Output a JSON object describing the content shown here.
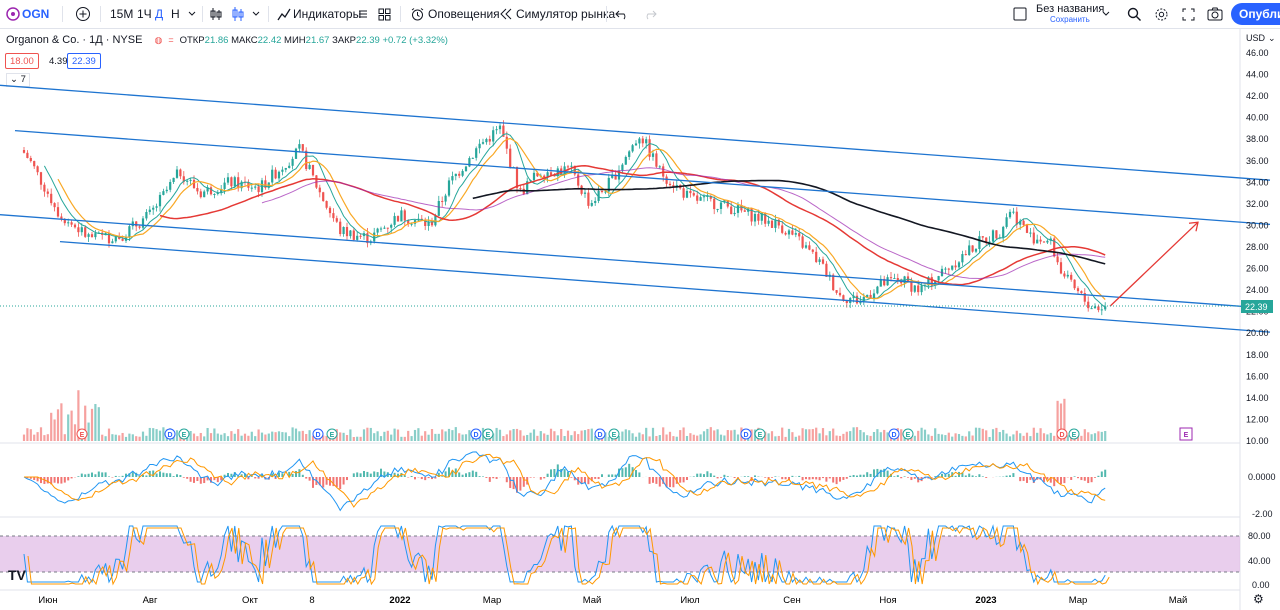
{
  "toolbar": {
    "symbol": "OGN",
    "add_symbol_icon": "plus-circle-icon",
    "intervals": [
      "15M",
      "1Ч",
      "Д",
      "Н"
    ],
    "active_interval": "Д",
    "indicators_label": "Индикаторы",
    "alerts_label": "Оповещения",
    "replay_label": "Симулятор рынка",
    "layout_name": "Без названия",
    "layout_status": "Сохранить",
    "publish_label": "Опубликовать"
  },
  "legend": {
    "title": "Organon & Co. · 1Д · NYSE",
    "open_label": "ОТКР",
    "open": "21.86",
    "high_label": "МАКС",
    "high": "22.42",
    "low_label": "МИН",
    "low": "21.67",
    "close_label": "ЗАКР",
    "close": "22.39",
    "change": "+0.72 (+3.32%)",
    "sell_price": "18.00",
    "spread": "4.39",
    "buy_price": "22.39",
    "indicators_count": "7"
  },
  "price_axis": {
    "currency": "USD",
    "labels": [
      "46.00",
      "44.00",
      "42.00",
      "40.00",
      "38.00",
      "36.00",
      "34.00",
      "32.00",
      "30.00",
      "28.00",
      "26.00",
      "24.00",
      "22.00",
      "20.00",
      "18.00",
      "16.00",
      "14.00",
      "12.00",
      "10.00"
    ],
    "last_price": "22.39",
    "macd_labels": [
      "0.0000",
      "-2.00"
    ],
    "stoch_labels": [
      "80.00",
      "40.00",
      "0.00"
    ]
  },
  "time_axis": {
    "labels": [
      "Июн",
      "Авг",
      "Окт",
      "8",
      "2022",
      "Мар",
      "Май",
      "Июл",
      "Сен",
      "Ноя",
      "2023",
      "Мар",
      "Май"
    ],
    "bold": [
      "2022",
      "2023"
    ]
  },
  "events": [
    "E",
    "D",
    "E",
    "D",
    "E",
    "D",
    "E",
    "D",
    "E",
    "D",
    "E",
    "D",
    "E",
    "D",
    "E"
  ],
  "colors": {
    "channel": "#1e74d0",
    "arrow": "#e53935",
    "ma_fast": "#e53935",
    "ma_slow": "#131722",
    "ma_purple": "#9c27b0",
    "up": "#26a69a",
    "down": "#ef5350",
    "stoch_band": "#e1bee7",
    "publish": "#2962ff"
  },
  "chart_data": {
    "type": "candlestick",
    "symbol": "OGN",
    "timeframe": "1D",
    "y_range": [
      20,
      46
    ],
    "last_close": 22.39,
    "price_path": [
      [
        0,
        31
      ],
      [
        10,
        38.5
      ],
      [
        30,
        36
      ],
      [
        60,
        31
      ],
      [
        90,
        28.8
      ],
      [
        120,
        29
      ],
      [
        150,
        31
      ],
      [
        180,
        35
      ],
      [
        200,
        33
      ],
      [
        230,
        34
      ],
      [
        260,
        33.5
      ],
      [
        290,
        36.2
      ],
      [
        300,
        37
      ],
      [
        320,
        33
      ],
      [
        340,
        29.5
      ],
      [
        370,
        28.8
      ],
      [
        400,
        31
      ],
      [
        430,
        30
      ],
      [
        450,
        34
      ],
      [
        480,
        37.5
      ],
      [
        500,
        39
      ],
      [
        520,
        33
      ],
      [
        540,
        35
      ],
      [
        570,
        35.2
      ],
      [
        590,
        32
      ],
      [
        610,
        34
      ],
      [
        640,
        38.5
      ],
      [
        660,
        35
      ],
      [
        690,
        32.5
      ],
      [
        720,
        32
      ],
      [
        750,
        31
      ],
      [
        780,
        30
      ],
      [
        800,
        28.5
      ],
      [
        820,
        26.5
      ],
      [
        840,
        23.5
      ],
      [
        860,
        23
      ],
      [
        880,
        24.5
      ],
      [
        900,
        25
      ],
      [
        920,
        24
      ],
      [
        940,
        25.5
      ],
      [
        960,
        27
      ],
      [
        980,
        28.5
      ],
      [
        1000,
        29.5
      ],
      [
        1010,
        31.5
      ],
      [
        1030,
        29
      ],
      [
        1050,
        28.5
      ],
      [
        1060,
        26
      ],
      [
        1070,
        24.5
      ],
      [
        1090,
        22.5
      ],
      [
        1105,
        22.39
      ]
    ],
    "channels": [
      {
        "name": "upper",
        "p1": [
          0,
          43
        ],
        "p2": [
          1270,
          34.2
        ]
      },
      {
        "name": "mid",
        "p1": [
          15,
          38.8
        ],
        "p2": [
          1270,
          30.1
        ]
      },
      {
        "name": "lower",
        "p1": [
          0,
          31
        ],
        "p2": [
          1270,
          22.3
        ]
      },
      {
        "name": "base",
        "p1": [
          60,
          28.5
        ],
        "p2": [
          1270,
          20.1
        ]
      }
    ],
    "forecast_arrow": {
      "from": [
        1110,
        22.5
      ],
      "to": [
        1198,
        30.3
      ]
    }
  }
}
